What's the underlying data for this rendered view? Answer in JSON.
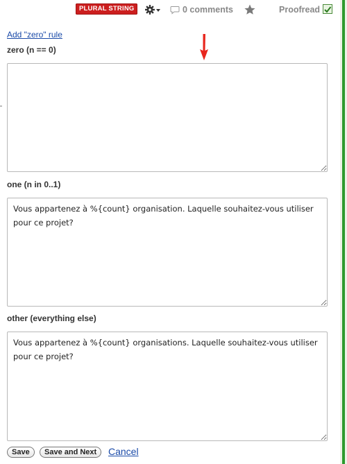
{
  "header": {
    "badge": "PLURAL STRING",
    "comments": "0 comments",
    "proofread_label": "Proofread",
    "proofread_checked": true
  },
  "add_zero_rule": "Add \"zero\" rule",
  "rules": [
    {
      "label": "zero (n == 0)",
      "value": ""
    },
    {
      "label": "one (n in 0..1)",
      "value": "Vous appartenez à %{count} organisation. Laquelle souhaitez-vous utiliser pour ce projet?"
    },
    {
      "label": "other (everything else)",
      "value": "Vous appartenez à %{count} organisations. Laquelle souhaitez-vous utiliser pour ce projet?"
    }
  ],
  "actions": {
    "save": "Save",
    "save_next": "Save and Next",
    "cancel": "Cancel"
  },
  "colors": {
    "badge": "#cc1f1f",
    "link": "#1a4aa8",
    "arrow": "#e8261d",
    "border_accent": "#2d9b2d"
  },
  "icons": {
    "gear": "gear-icon",
    "comment": "comment-icon",
    "star": "star-icon",
    "arrow": "arrow-down-icon"
  }
}
